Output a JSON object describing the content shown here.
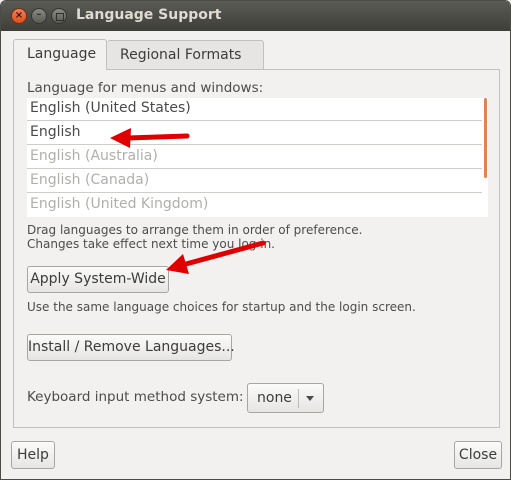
{
  "window": {
    "title": "Language Support",
    "controls": {
      "close": "×",
      "minimize": "–",
      "maximize": ""
    }
  },
  "tabs": [
    {
      "label": "Language",
      "active": true
    },
    {
      "label": "Regional Formats",
      "active": false
    }
  ],
  "language_tab": {
    "list_label": "Language for menus and windows:",
    "languages": [
      {
        "name": "English (United States)",
        "enabled": true
      },
      {
        "name": "English",
        "enabled": true
      },
      {
        "name": "English (Australia)",
        "enabled": false
      },
      {
        "name": "English (Canada)",
        "enabled": false
      },
      {
        "name": "English (United Kingdom)",
        "enabled": false
      }
    ],
    "hint_line1": "Drag languages to arrange them in order of preference.",
    "hint_line2": "Changes take effect next time you log in.",
    "apply_button": "Apply System-Wide",
    "apply_note": "Use the same language choices for startup and the login screen.",
    "install_button": "Install / Remove Languages...",
    "keyboard_label": "Keyboard input method system:",
    "keyboard_value": "none"
  },
  "footer": {
    "help_button": "Help",
    "close_button": "Close"
  },
  "colors": {
    "titlebar": "#3f3f3a",
    "scrollbar_accent": "#dd8552",
    "annotation_arrow": "#e00000"
  },
  "icons": {
    "combo": "chevron-down-icon",
    "close": "close-icon",
    "minimize": "minimize-icon",
    "maximize": "maximize-icon"
  }
}
